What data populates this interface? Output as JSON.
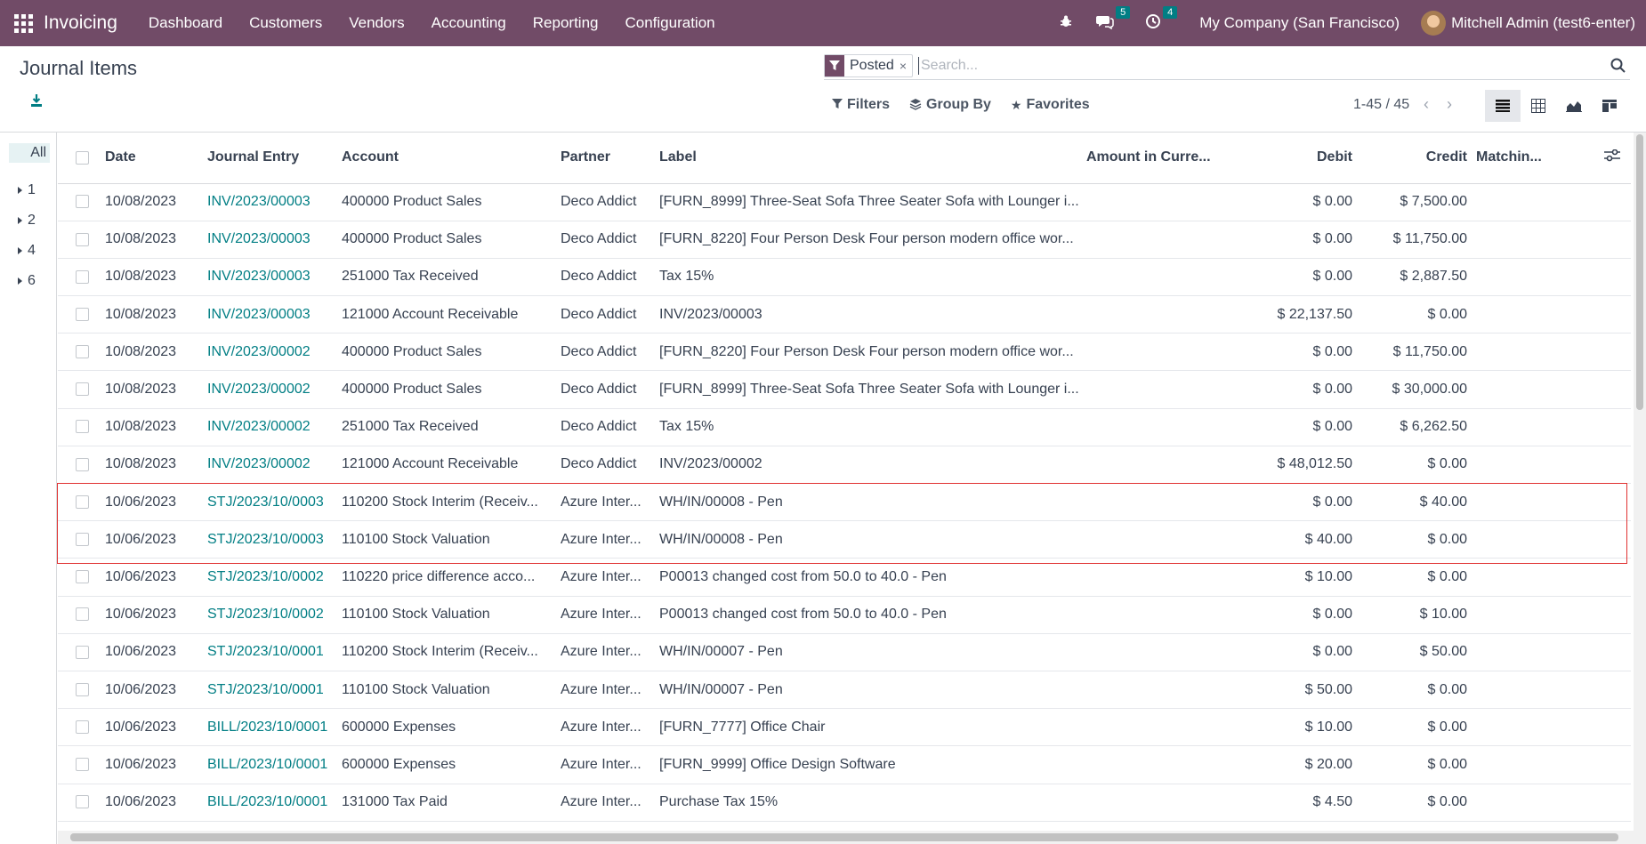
{
  "nav": {
    "brand": "Invoicing",
    "menu": [
      "Dashboard",
      "Customers",
      "Vendors",
      "Accounting",
      "Reporting",
      "Configuration"
    ],
    "messages_count": "5",
    "activities_count": "4",
    "company": "My Company (San Francisco)",
    "user": "Mitchell Admin (test6-enter)"
  },
  "page": {
    "title": "Journal Items"
  },
  "search": {
    "facet": "Posted",
    "placeholder": "Search..."
  },
  "filters": {
    "filters_label": "Filters",
    "groupby_label": "Group By",
    "favorites_label": "Favorites"
  },
  "pager": {
    "value": "1-45 / 45"
  },
  "sidepanel": {
    "all": "All",
    "items": [
      "1",
      "2",
      "4",
      "6"
    ]
  },
  "table": {
    "columns": [
      "Date",
      "Journal Entry",
      "Account",
      "Partner",
      "Label",
      "Amount in Curre...",
      "Debit",
      "Credit",
      "Matchin..."
    ],
    "rows": [
      {
        "date": "10/08/2023",
        "entry": "INV/2023/00003",
        "account": "400000 Product Sales",
        "partner": "Deco Addict",
        "label": "[FURN_8999] Three-Seat Sofa Three Seater Sofa with Lounger i...",
        "debit": "$ 0.00",
        "credit": "$ 7,500.00"
      },
      {
        "date": "10/08/2023",
        "entry": "INV/2023/00003",
        "account": "400000 Product Sales",
        "partner": "Deco Addict",
        "label": "[FURN_8220] Four Person Desk Four person modern office wor...",
        "debit": "$ 0.00",
        "credit": "$ 11,750.00"
      },
      {
        "date": "10/08/2023",
        "entry": "INV/2023/00003",
        "account": "251000 Tax Received",
        "partner": "Deco Addict",
        "label": "Tax 15%",
        "debit": "$ 0.00",
        "credit": "$ 2,887.50"
      },
      {
        "date": "10/08/2023",
        "entry": "INV/2023/00003",
        "account": "121000 Account Receivable",
        "partner": "Deco Addict",
        "label": "INV/2023/00003",
        "debit": "$ 22,137.50",
        "credit": "$ 0.00"
      },
      {
        "date": "10/08/2023",
        "entry": "INV/2023/00002",
        "account": "400000 Product Sales",
        "partner": "Deco Addict",
        "label": "[FURN_8220] Four Person Desk Four person modern office wor...",
        "debit": "$ 0.00",
        "credit": "$ 11,750.00"
      },
      {
        "date": "10/08/2023",
        "entry": "INV/2023/00002",
        "account": "400000 Product Sales",
        "partner": "Deco Addict",
        "label": "[FURN_8999] Three-Seat Sofa Three Seater Sofa with Lounger i...",
        "debit": "$ 0.00",
        "credit": "$ 30,000.00"
      },
      {
        "date": "10/08/2023",
        "entry": "INV/2023/00002",
        "account": "251000 Tax Received",
        "partner": "Deco Addict",
        "label": "Tax 15%",
        "debit": "$ 0.00",
        "credit": "$ 6,262.50"
      },
      {
        "date": "10/08/2023",
        "entry": "INV/2023/00002",
        "account": "121000 Account Receivable",
        "partner": "Deco Addict",
        "label": "INV/2023/00002",
        "debit": "$ 48,012.50",
        "credit": "$ 0.00"
      },
      {
        "date": "10/06/2023",
        "entry": "STJ/2023/10/0003",
        "account": "110200 Stock Interim (Receiv...",
        "partner": "Azure Inter...",
        "label": "WH/IN/00008 - Pen",
        "debit": "$ 0.00",
        "credit": "$ 40.00"
      },
      {
        "date": "10/06/2023",
        "entry": "STJ/2023/10/0003",
        "account": "110100 Stock Valuation",
        "partner": "Azure Inter...",
        "label": "WH/IN/00008 - Pen",
        "debit": "$ 40.00",
        "credit": "$ 0.00"
      },
      {
        "date": "10/06/2023",
        "entry": "STJ/2023/10/0002",
        "account": "110220 price difference acco...",
        "partner": "Azure Inter...",
        "label": "P00013 changed cost from 50.0 to 40.0 - Pen",
        "debit": "$ 10.00",
        "credit": "$ 0.00"
      },
      {
        "date": "10/06/2023",
        "entry": "STJ/2023/10/0002",
        "account": "110100 Stock Valuation",
        "partner": "Azure Inter...",
        "label": "P00013 changed cost from 50.0 to 40.0 - Pen",
        "debit": "$ 0.00",
        "credit": "$ 10.00"
      },
      {
        "date": "10/06/2023",
        "entry": "STJ/2023/10/0001",
        "account": "110200 Stock Interim (Receiv...",
        "partner": "Azure Inter...",
        "label": "WH/IN/00007 - Pen",
        "debit": "$ 0.00",
        "credit": "$ 50.00"
      },
      {
        "date": "10/06/2023",
        "entry": "STJ/2023/10/0001",
        "account": "110100 Stock Valuation",
        "partner": "Azure Inter...",
        "label": "WH/IN/00007 - Pen",
        "debit": "$ 50.00",
        "credit": "$ 0.00"
      },
      {
        "date": "10/06/2023",
        "entry": "BILL/2023/10/0001",
        "account": "600000 Expenses",
        "partner": "Azure Inter...",
        "label": "[FURN_7777] Office Chair",
        "debit": "$ 10.00",
        "credit": "$ 0.00"
      },
      {
        "date": "10/06/2023",
        "entry": "BILL/2023/10/0001",
        "account": "600000 Expenses",
        "partner": "Azure Inter...",
        "label": "[FURN_9999] Office Design Software",
        "debit": "$ 20.00",
        "credit": "$ 0.00"
      },
      {
        "date": "10/06/2023",
        "entry": "BILL/2023/10/0001",
        "account": "131000 Tax Paid",
        "partner": "Azure Inter...",
        "label": "Purchase Tax 15%",
        "debit": "$ 4.50",
        "credit": "$ 0.00"
      }
    ]
  },
  "colors": {
    "brand": "#714B67",
    "link": "#017E84",
    "highlight": "#e03131"
  }
}
